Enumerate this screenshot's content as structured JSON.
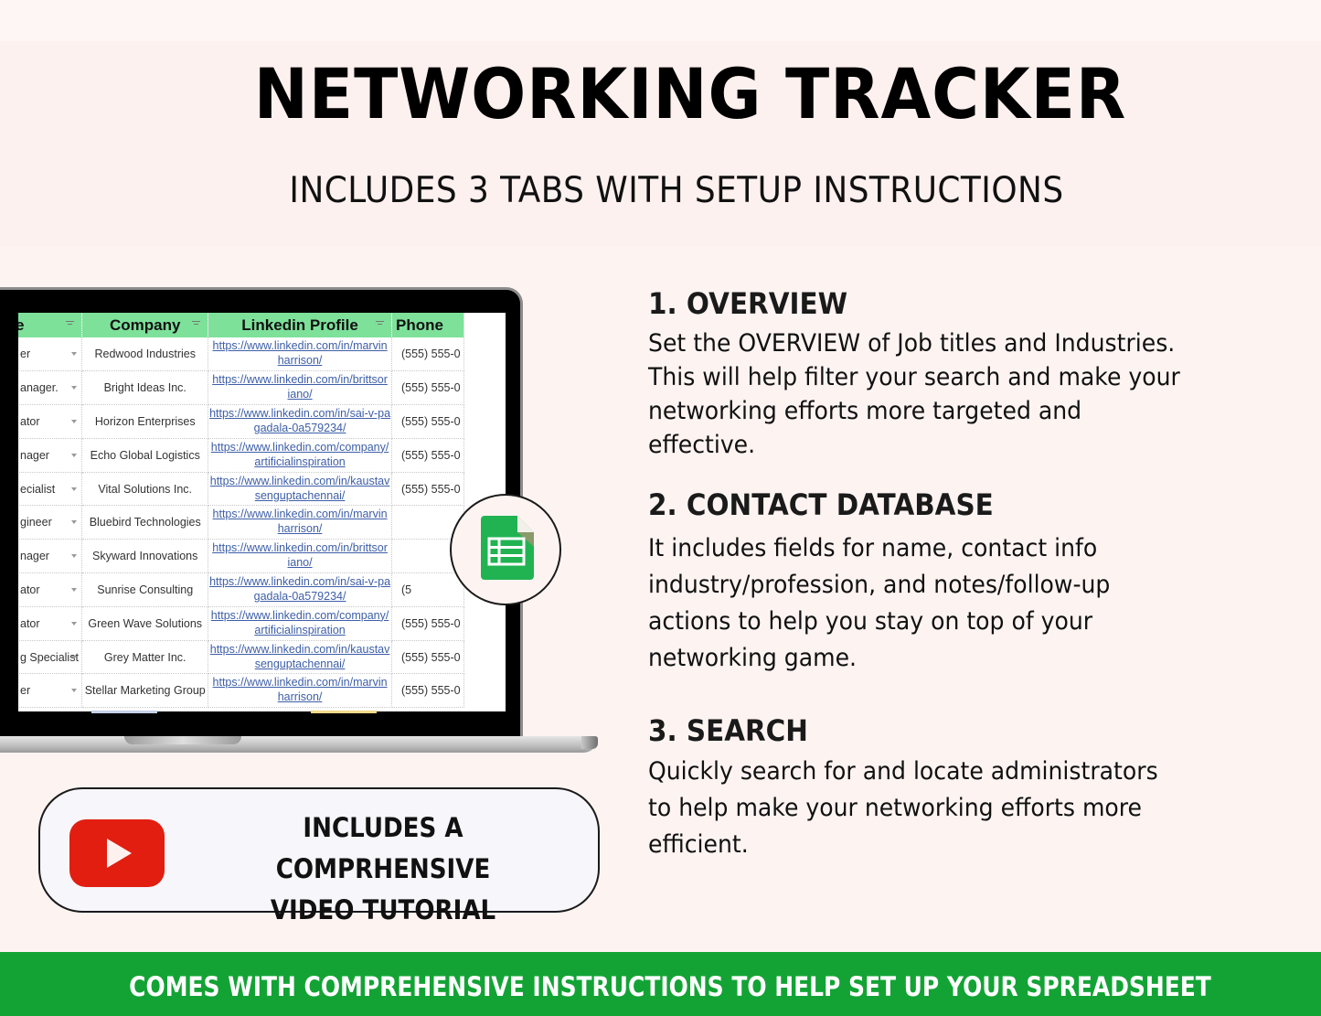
{
  "header": {
    "title": "NETWORKING TRACKER",
    "subtitle": "INCLUDES 3 TABS WITH SETUP INSTRUCTIONS"
  },
  "spreadsheet_preview": {
    "columns": [
      {
        "label": "e"
      },
      {
        "label": "Company"
      },
      {
        "label": "Linkedin Profile"
      },
      {
        "label": "Phone"
      }
    ],
    "rows": [
      {
        "title": "er",
        "company": "Redwood Industries",
        "linkedin": [
          "https://www.linkedin.com/in/marvin",
          "harrison/"
        ],
        "phone": "(555) 555-0"
      },
      {
        "title": "anager.",
        "company": "Bright Ideas Inc.",
        "linkedin": [
          "https://www.linkedin.com/in/brittsor",
          "iano/"
        ],
        "phone": "(555) 555-0"
      },
      {
        "title": "ator",
        "company": "Horizon Enterprises",
        "linkedin": [
          "https://www.linkedin.com/in/sai-v-pa",
          "gadala-0a579234/"
        ],
        "phone": "(555) 555-0"
      },
      {
        "title": "nager",
        "company": "Echo Global Logistics",
        "linkedin": [
          "https://www.linkedin.com/company/",
          "artificialinspiration"
        ],
        "phone": "(555) 555-0"
      },
      {
        "title": "ecialist",
        "company": "Vital Solutions Inc.",
        "linkedin": [
          "https://www.linkedin.com/in/kaustav",
          "senguptachennai/"
        ],
        "phone": "(555) 555-0"
      },
      {
        "title": "gineer",
        "company": "Bluebird Technologies",
        "linkedin": [
          "https://www.linkedin.com/in/marvin",
          "harrison/"
        ],
        "phone": ""
      },
      {
        "title": "nager",
        "company": "Skyward Innovations",
        "linkedin": [
          "https://www.linkedin.com/in/brittsor",
          "iano/"
        ],
        "phone": ""
      },
      {
        "title": "ator",
        "company": "Sunrise Consulting",
        "linkedin": [
          "https://www.linkedin.com/in/sai-v-pa",
          "gadala-0a579234/"
        ],
        "phone": "(5"
      },
      {
        "title": "ator",
        "company": "Green Wave Solutions",
        "linkedin": [
          "https://www.linkedin.com/company/",
          "artificialinspiration"
        ],
        "phone": "(555) 555-0"
      },
      {
        "title": "g Specialist",
        "company": "Grey Matter Inc.",
        "linkedin": [
          "https://www.linkedin.com/in/kaustav",
          "senguptachennai/"
        ],
        "phone": "(555) 555-0"
      },
      {
        "title": "er",
        "company": "Stellar Marketing Group",
        "linkedin": [
          "https://www.linkedin.com/in/marvin",
          "harrison/"
        ],
        "phone": "(555) 555-0"
      }
    ],
    "header_color": "#7de19a",
    "link_color": "#3d5ea8"
  },
  "badges": {
    "sheets_icon": "google-sheets-icon",
    "video_icon": "youtube-play-icon",
    "video_text_line1": "INCLUDES A COMPRHENSIVE",
    "video_text_line2": "VIDEO TUTORIAL"
  },
  "sections": [
    {
      "heading": "1. OVERVIEW",
      "lines": [
        "Set the OVERVIEW of Job titles and Industries.",
        "This will help filter your search and make your",
        "networking efforts more targeted and",
        "effective."
      ]
    },
    {
      "heading": "2. CONTACT DATABASE",
      "lines": [
        "It includes fields for name, contact info",
        "industry/profession, and notes/follow-up",
        "actions to help you stay on top of your",
        "networking game."
      ]
    },
    {
      "heading": "3. SEARCH",
      "lines": [
        "Quickly search for and locate administrators",
        "to help make your networking efforts more",
        "efficient."
      ]
    }
  ],
  "footer": {
    "text": "COMES WITH COMPREHENSIVE INSTRUCTIONS TO HELP SET UP YOUR SPREADSHEET",
    "color": "#13a335"
  }
}
